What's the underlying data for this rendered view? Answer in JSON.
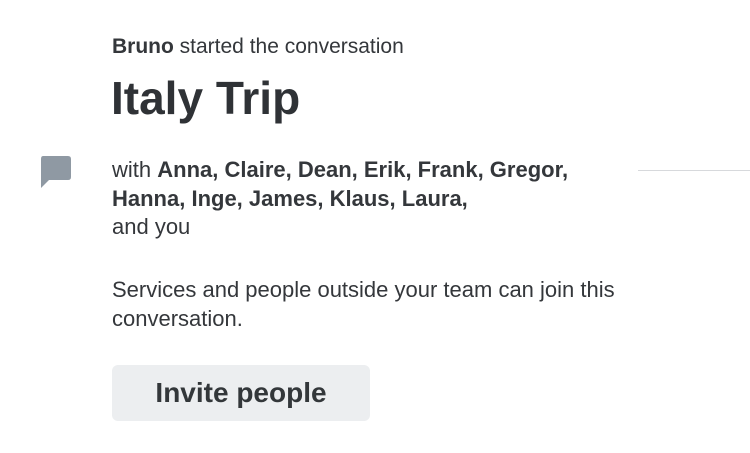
{
  "header": {
    "starter_name": "Bruno",
    "starter_text": " started the conversation",
    "title": "Italy Trip"
  },
  "participants": {
    "prefix": "with ",
    "names": "Anna, Claire, Dean, Erik, Frank, Gregor, Hanna, Inge, James, Klaus, Laura,",
    "suffix": " and you",
    "icon": "chat-bubble-icon"
  },
  "notice": {
    "text": "Services and people outside your team can join this conversation."
  },
  "actions": {
    "invite_label": "Invite people"
  },
  "colors": {
    "text": "#33373a",
    "icon": "#8f99a3",
    "button_bg": "#eceef0",
    "divider": "#d7d9dc"
  }
}
